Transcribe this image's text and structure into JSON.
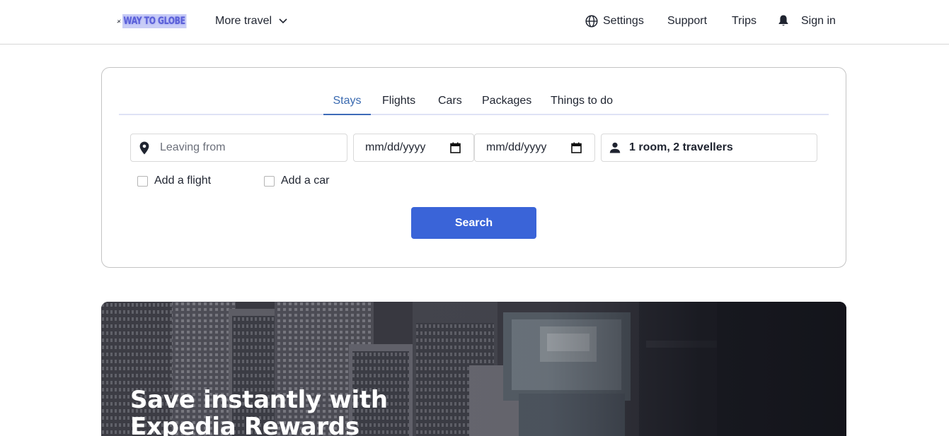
{
  "header": {
    "logo_text": "WAY TO GLOBE",
    "more_travel": "More travel",
    "nav": {
      "settings": "Settings",
      "support": "Support",
      "trips": "Trips",
      "sign_in": "Sign in"
    }
  },
  "search_card": {
    "tabs": [
      {
        "label": "Stays",
        "active": true
      },
      {
        "label": "Flights",
        "active": false
      },
      {
        "label": "Cars",
        "active": false
      },
      {
        "label": "Packages",
        "active": false
      },
      {
        "label": "Things to do",
        "active": false
      }
    ],
    "leaving_from": {
      "placeholder": "Leaving from",
      "value": ""
    },
    "check_in": {
      "value": "mm/dd/yyyy"
    },
    "check_out": {
      "value": "mm/dd/yyyy"
    },
    "travellers": "1 room, 2 travellers",
    "add_flight": {
      "label": "Add a flight",
      "checked": false
    },
    "add_car": {
      "label": "Add a car",
      "checked": false
    },
    "search_button": "Search"
  },
  "hero": {
    "title_line1": "Save instantly with",
    "title_line2": "Expedia Rewards"
  },
  "colors": {
    "accent": "#3a64d8",
    "active_tab": "#3a6ab0",
    "text": "#1f2430",
    "border": "#d9d9d9"
  },
  "icons": [
    "plane-logo-icon",
    "chevron-down-icon",
    "globe-icon",
    "bell-icon",
    "map-pin-icon",
    "calendar-icon",
    "person-icon",
    "checkbox-icon"
  ]
}
